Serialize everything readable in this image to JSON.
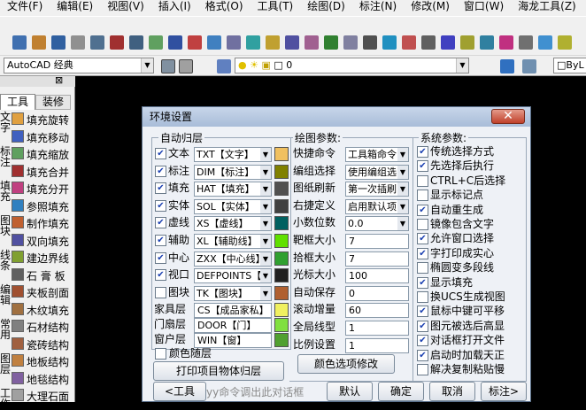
{
  "menu": [
    "文件(F)",
    "编辑(E)",
    "视图(V)",
    "插入(I)",
    "格式(O)",
    "工具(T)",
    "绘图(D)",
    "标注(N)",
    "修改(M)",
    "窗口(W)",
    "海龙工具(Z)",
    "帮助"
  ],
  "toolbar2": {
    "workspace": "AutoCAD 经典",
    "layer": "0",
    "bylayer": "ByL"
  },
  "left_panel": {
    "tabs": [
      "工具",
      "装修"
    ],
    "vertical_labels": [
      "文字",
      "标注",
      "填充",
      "图块",
      "线条",
      "编辑",
      "常用",
      "图层",
      "工作"
    ],
    "items": [
      "填充旋转",
      "填充移动",
      "填充缩放",
      "填充合并",
      "填充分开",
      "参照填充",
      "制作填充",
      "双向填充",
      "建边界线",
      "石 膏 板",
      "夹板剖面",
      "木纹填充",
      "石材结构",
      "瓷砖结构",
      "地板结构",
      "地毯结构",
      "大理石面"
    ]
  },
  "dialog": {
    "title": "环境设置",
    "close": "✕",
    "auto_layer": {
      "title": "自动归层",
      "rows": [
        {
          "label": "文本",
          "checked": true,
          "value": "TXT【文字】",
          "color": "#f0c060"
        },
        {
          "label": "标注",
          "checked": true,
          "value": "DIM【标注】",
          "color": "#808000"
        },
        {
          "label": "填充",
          "checked": true,
          "value": "HAT【填充】",
          "color": "#505050"
        },
        {
          "label": "实体",
          "checked": true,
          "value": "SOL【实体】",
          "color": "#404040"
        },
        {
          "label": "虚线",
          "checked": true,
          "value": "XS【虚线】",
          "color": "#006060"
        },
        {
          "label": "辅助",
          "checked": true,
          "value": "XL【辅助线】",
          "color": "#60e000"
        },
        {
          "label": "中心",
          "checked": true,
          "value": "ZXX【中心线】",
          "color": "#30a030"
        },
        {
          "label": "视口",
          "checked": true,
          "value": "DEFPOINTS【",
          "color": "#202020"
        },
        {
          "label": "图块",
          "checked": false,
          "value": "TK【图块】",
          "color": "#b06030"
        }
      ],
      "text_rows": [
        {
          "label": "家具层",
          "value": "CS【成品家私】",
          "color": "#f0f060"
        },
        {
          "label": "门扇层",
          "value": "DOOR【门】",
          "color": "#80e040"
        },
        {
          "label": "窗户层",
          "value": "WIN【窗】",
          "color": "#50a030"
        }
      ],
      "color_follow": "颜色随层",
      "print_button": "打印项目物体归层"
    },
    "draw_params": {
      "title": "绘图参数:",
      "rows": [
        {
          "label": "快捷命令",
          "value": "工具箱命令"
        },
        {
          "label": "编组选择",
          "value": "使用编组选"
        },
        {
          "label": "图纸刷新",
          "value": "第一次插刷"
        },
        {
          "label": "右捷定义",
          "value": "启用默认项"
        },
        {
          "label": "小数位数",
          "value": "0.0"
        },
        {
          "label": "靶框大小",
          "value": "7"
        },
        {
          "label": "拾框大小",
          "value": "7"
        },
        {
          "label": "光标大小",
          "value": "100"
        },
        {
          "label": "自动保存",
          "value": "0"
        },
        {
          "label": "滚动增量",
          "value": "60"
        },
        {
          "label": "全局线型",
          "value": "1"
        },
        {
          "label": "比例设置",
          "value": "1"
        }
      ],
      "color_button": "颜色选项修改"
    },
    "sys_params": {
      "title": "系统参数:",
      "items": [
        {
          "label": "传统选择方式",
          "checked": true
        },
        {
          "label": "先选择后执行",
          "checked": true
        },
        {
          "label": "CTRL+C后选择",
          "checked": false
        },
        {
          "label": "显示标记点",
          "checked": false
        },
        {
          "label": "自动重生成",
          "checked": true
        },
        {
          "label": "镜像包含文字",
          "checked": false
        },
        {
          "label": "允许窗口选择",
          "checked": true
        },
        {
          "label": "字打印成实心",
          "checked": true
        },
        {
          "label": "椭圆变多段线",
          "checked": false
        },
        {
          "label": "显示填充",
          "checked": true
        },
        {
          "label": "换UCS生成视图",
          "checked": false
        },
        {
          "label": "鼠标中键可平移",
          "checked": true
        },
        {
          "label": "图元被选后高显",
          "checked": true
        },
        {
          "label": "对话框打开文件",
          "checked": true
        },
        {
          "label": "启动时加载天正",
          "checked": true
        },
        {
          "label": "解决复制粘贴慢",
          "checked": false
        }
      ]
    },
    "bottom": {
      "prev": "<工具",
      "hint": "yy命令调出此对话框",
      "default": "默认",
      "ok": "确定",
      "cancel": "取消",
      "next": "标注>"
    }
  }
}
